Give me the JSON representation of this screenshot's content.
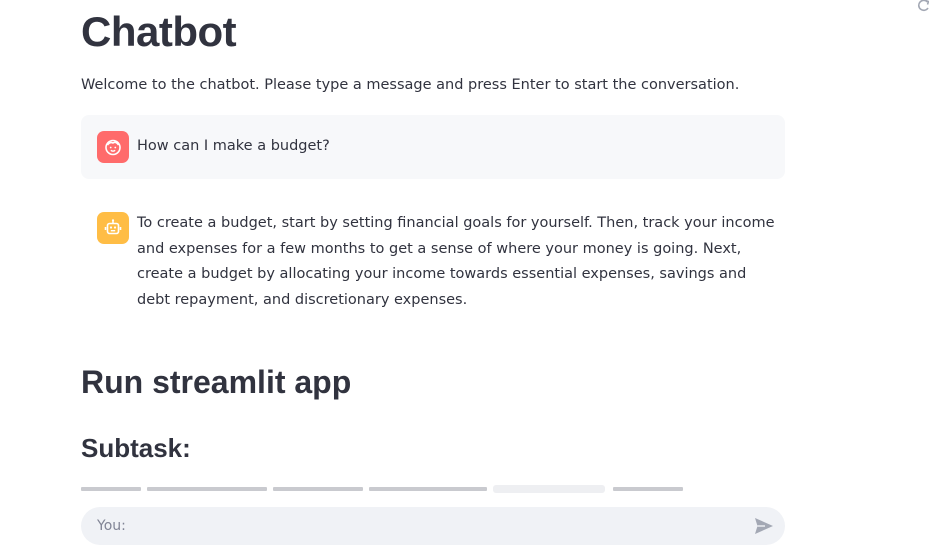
{
  "page": {
    "title": "Chatbot",
    "welcome": "Welcome to the chatbot. Please type a message and press Enter to start the conversation."
  },
  "messages": [
    {
      "role": "user",
      "avatar_icon": "user-face-icon",
      "text": "How can I make a budget?"
    },
    {
      "role": "assistant",
      "avatar_icon": "robot-icon",
      "text": "To create a budget, start by setting financial goals for yourself. Then, track your income and expenses for a few months to get a sense of where your money is going. Next, create a budget by allocating your income towards essential expenses, savings and debt repayment, and discretionary expenses."
    }
  ],
  "sections": {
    "heading": "Run streamlit app",
    "subheading": "Subtask:"
  },
  "chat_input": {
    "placeholder": "You:",
    "value": "",
    "send_icon": "send-icon"
  },
  "colors": {
    "text": "#31333f",
    "user_avatar": "#ff6b6b",
    "bot_avatar": "#ffbd45",
    "user_bubble": "#f7f8fa",
    "input_bg": "#f0f2f6"
  }
}
